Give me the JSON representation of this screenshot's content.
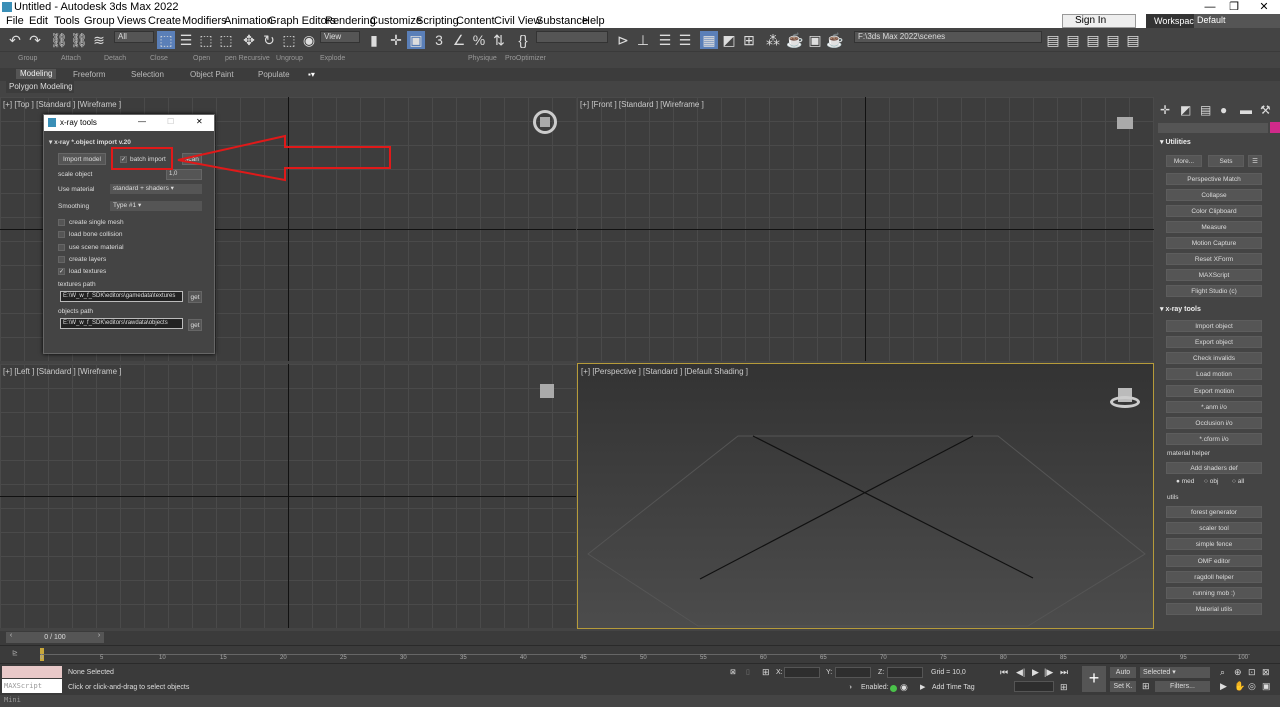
{
  "window": {
    "title": "Untitled - Autodesk 3ds Max 2022",
    "minimize": "—",
    "maximize": "❐",
    "close": "✕"
  },
  "menu": [
    "File",
    "Edit",
    "Tools",
    "Group",
    "Views",
    "Create",
    "Modifiers",
    "Animation",
    "Graph Editors",
    "Rendering",
    "Customize",
    "Scripting",
    "Content",
    "Civil View",
    "Substance",
    "Help"
  ],
  "signin": "Sign In",
  "workspace": {
    "label": "Workspaces:",
    "value": "Default"
  },
  "toolbar": {
    "selection_filter": "All",
    "ref_coord": "View",
    "named_sel": "",
    "project_path": "F:\\3ds Max 2022\\scenes"
  },
  "toolbar2": [
    "Group",
    "Attach",
    "Detach",
    "Close",
    "Open",
    "pen Recursive",
    "Ungroup",
    "Explode",
    "Physique",
    "ProOptimizer"
  ],
  "ribbon": {
    "tabs": [
      "Modeling",
      "Freeform",
      "Selection",
      "Object Paint",
      "Populate"
    ],
    "poly_tab": "Polygon Modeling"
  },
  "viewports": {
    "top": "[+] [Top ] [Standard ] [Wireframe ]",
    "front": "[+] [Front ] [Standard ] [Wireframe ]",
    "left": "[+] [Left ] [Standard ] [Wireframe ]",
    "perspective": "[+] [Perspective ] [Standard ] [Default Shading ]"
  },
  "command_panel": {
    "utilities_head": "Utilities",
    "more": "More...",
    "sets": "Sets",
    "utilities": [
      "Perspective Match",
      "Collapse",
      "Color Clipboard",
      "Measure",
      "Motion Capture",
      "Reset XForm",
      "MAXScript",
      "Flight Studio (c)"
    ],
    "xray_head": "x-ray tools",
    "xray": [
      "Import object",
      "Export object",
      "Check invalids",
      "Load motion",
      "Export motion",
      "*.anm i/o",
      "Occlusion i/o",
      "*.cform i/o"
    ],
    "material_helper": "material helper",
    "add_shaders": "Add shaders def",
    "radio": [
      "med",
      "obj",
      "all"
    ],
    "utils_head": "utils",
    "utils": [
      "forest generator",
      "scaler tool",
      "simple fence",
      "OMF editor",
      "ragdoll helper",
      "running mob :)",
      "Material utils"
    ]
  },
  "dialog": {
    "title": "x-ray tools",
    "rollout": "x-ray *.object import v.20",
    "import_model": "Import model",
    "batch_import": "batch import",
    "scan": "scan",
    "scale_label": "scale object",
    "scale_value": "1,0",
    "material_label": "Use material",
    "material_value": "standard + shaders",
    "smoothing_label": "Smoothing",
    "smoothing_value": "Type #1",
    "checks": [
      {
        "label": "create single mesh",
        "checked": false
      },
      {
        "label": "load bone collision",
        "checked": false
      },
      {
        "label": "use scene material",
        "checked": false
      },
      {
        "label": "create layers",
        "checked": false
      },
      {
        "label": "load textures",
        "checked": true
      }
    ],
    "textures_label": "textures path",
    "textures_value": "E:\\W_w_f_SDK\\editors\\gamedata\\textures",
    "objects_label": "objects path",
    "objects_value": "E:\\W_w_f_SDK\\editors\\rawdata\\objects",
    "get": "get"
  },
  "timeline": {
    "range": "0 / 100"
  },
  "trackbar_ticks": [
    "0",
    "5",
    "10",
    "15",
    "20",
    "25",
    "30",
    "35",
    "40",
    "45",
    "50",
    "55",
    "60",
    "65",
    "70",
    "75",
    "80",
    "85",
    "90",
    "95",
    "100"
  ],
  "status": {
    "maxscript": "MAXScript Mini",
    "none_selected": "None Selected",
    "prompt": "Click or click-and-drag to select objects",
    "x": "X:",
    "y": "Y:",
    "z": "Z:",
    "grid": "Grid = 10,0",
    "enabled": "Enabled:",
    "add_time_tag": "Add Time Tag",
    "auto": "Auto",
    "set_k": "Set K.",
    "selected": "Selected",
    "filters": "Filters..."
  },
  "colors": {
    "annotation": "#e01919",
    "viewport_active_border": "#b69b3a",
    "xray_accent": "#d02a8a"
  }
}
